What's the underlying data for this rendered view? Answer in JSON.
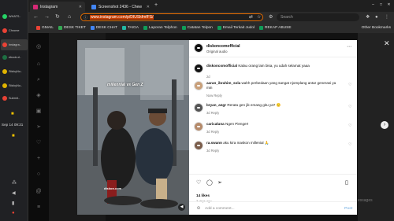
{
  "os": {
    "apps": [
      {
        "label": "WHATS..",
        "color": "#25d366"
      },
      {
        "label": "Chrome",
        "color": "#e94235"
      },
      {
        "label": "Instagra..",
        "color": "#e94235"
      },
      {
        "label": "ebook.xl..",
        "color": "#1d6f42"
      },
      {
        "label": "StickyNo..",
        "color": "#e0b300"
      },
      {
        "label": "StickyNo..",
        "color": "#e0b300"
      },
      {
        "label": "Submit..",
        "color": "#e94235"
      }
    ],
    "clock": "Sep 14  09:21"
  },
  "browser": {
    "tabs": [
      {
        "label": "Instagram",
        "icon": "instagram-icon",
        "color": "#d62976"
      },
      {
        "label": "Screenshot 2436 - Chew",
        "icon": "image-icon",
        "color": "#4285f4"
      }
    ],
    "new_tab": "+",
    "url": "www.instagram.com/p/DIUSkfmfFS/",
    "search_placeholder": "Search",
    "bookmarks": [
      {
        "label": "GMAIL",
        "color": "#ea4335"
      },
      {
        "label": "DESK TIKET",
        "color": "#34a853"
      },
      {
        "label": "DESK CHAT",
        "color": "#4285f4"
      },
      {
        "label": "TAIGA",
        "color": "#22b8a4"
      },
      {
        "label": "Laporan Telphon",
        "color": "#0f9d58"
      },
      {
        "label": "Catatan Telpon",
        "color": "#0f9d58"
      },
      {
        "label": "Email Terkait Judol",
        "color": "#0f9d58"
      },
      {
        "label": "REKAP ABUSE",
        "color": "#0f9d58"
      }
    ],
    "other_bookmarks": "Other Bookmarks"
  },
  "video": {
    "overlay_text": "millennial vs Gen Z",
    "watermark": "diskon.com"
  },
  "post": {
    "username": "diskoncomofficial",
    "subtitle": "Original audio",
    "caption_user": "diskoncomofficial",
    "caption": "Kalau orang lain bisa, yu udah selamat yaaa",
    "caption_time": "2d",
    "comments": [
      {
        "user": "aaran_ibrahim_sola",
        "text": "wahh perbedaan yang sangat njomplang antar generasi ya min",
        "meta": "Now   Reply"
      },
      {
        "user": "bryan_angr",
        "text": "Rerata gen jik emang gitu ya? 🙂",
        "meta": "3d   Reply"
      },
      {
        "user": "caricaluna",
        "text": "Ngen Pienger!",
        "meta": "3d   Reply"
      },
      {
        "user": "ra.swann",
        "text": "aku kira maskon millenial 🙏",
        "meta": "3d   Reply"
      }
    ],
    "likes": "14 likes",
    "posted": "3 days ago",
    "add_comment_placeholder": "Add a comment...",
    "post_label": "Post"
  },
  "background": {
    "message_hint": "essages"
  }
}
